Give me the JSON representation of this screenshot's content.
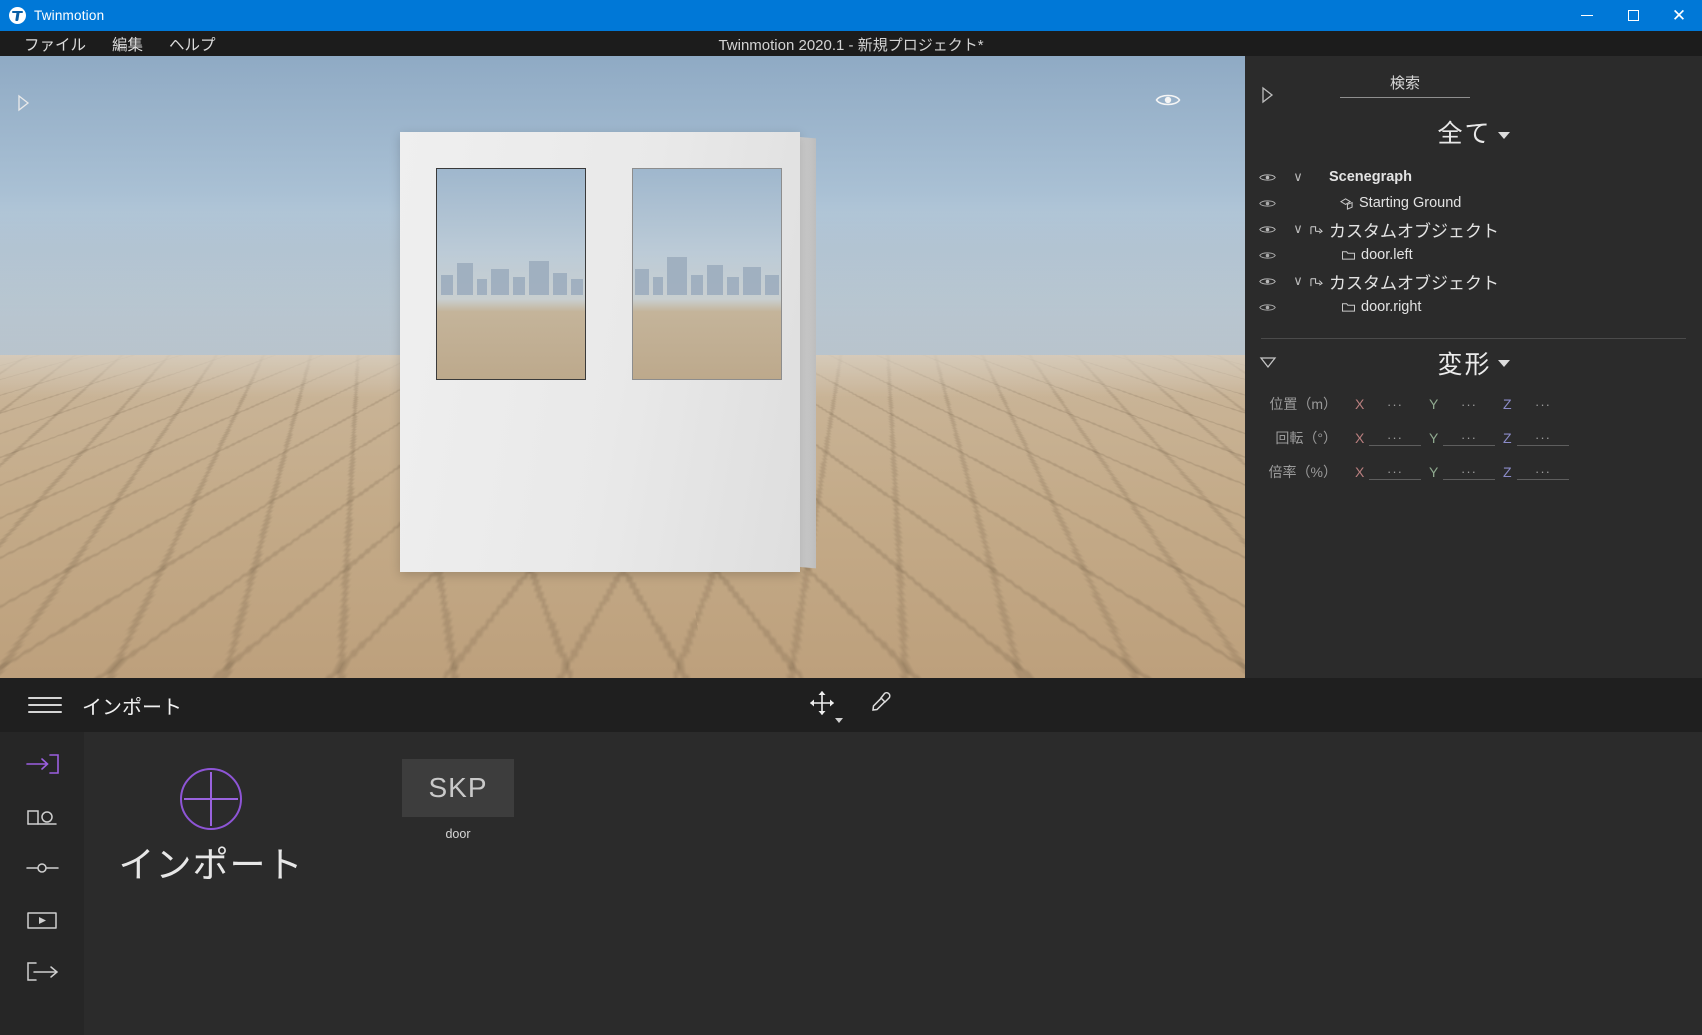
{
  "window": {
    "app_name": "Twinmotion",
    "document_title": "Twinmotion 2020.1 - 新規プロジェクト*",
    "controls": {
      "minimize": "—",
      "maximize": "□",
      "close": "✕"
    },
    "accent_titlebar_color": "#0078d7"
  },
  "menubar": {
    "items": [
      {
        "label": "ファイル"
      },
      {
        "label": "編集"
      },
      {
        "label": "ヘルプ"
      }
    ]
  },
  "viewport": {
    "collapse_arrow": "▷",
    "eye_toggle": "visibility-eye"
  },
  "right_panel": {
    "collapse_arrow": "▷",
    "search": {
      "label": "検索",
      "placeholder": "検索",
      "value": ""
    },
    "filter": {
      "label": "全て",
      "caret": "▾"
    },
    "tree": [
      {
        "label": "Scenegraph",
        "level": 0,
        "chevron": "∨",
        "icon": "",
        "bold": true,
        "japanese": false
      },
      {
        "label": "Starting Ground",
        "level": 1,
        "chevron": "",
        "icon": "ground-icon",
        "bold": false,
        "japanese": false
      },
      {
        "label": "カスタムオブジェクト",
        "level": 0,
        "chevron": "∨",
        "icon": "custom-obj-icon",
        "bold": false,
        "japanese": true
      },
      {
        "label": "door.left",
        "level": 2,
        "chevron": "",
        "icon": "folder-icon",
        "bold": false,
        "japanese": false
      },
      {
        "label": "カスタムオブジェクト",
        "level": 0,
        "chevron": "∨",
        "icon": "custom-obj-icon",
        "bold": false,
        "japanese": true
      },
      {
        "label": "door.right",
        "level": 2,
        "chevron": "",
        "icon": "folder-icon",
        "bold": false,
        "japanese": false
      }
    ],
    "transform": {
      "collapse_arrow": "▽",
      "title": "変形",
      "caret": "▾",
      "rows": [
        {
          "label": "位置（m）",
          "underline": false,
          "axes": [
            {
              "axis": "X",
              "value": "···",
              "color": "#b97f7f"
            },
            {
              "axis": "Y",
              "value": "···",
              "color": "#8fa98f"
            },
            {
              "axis": "Z",
              "value": "···",
              "color": "#8b8bc8"
            }
          ]
        },
        {
          "label": "回転（°）",
          "underline": true,
          "axes": [
            {
              "axis": "X",
              "value": "···",
              "color": "#b97f7f"
            },
            {
              "axis": "Y",
              "value": "···",
              "color": "#8fa98f"
            },
            {
              "axis": "Z",
              "value": "···",
              "color": "#8b8bc8"
            }
          ]
        },
        {
          "label": "倍率（%）",
          "underline": true,
          "axes": [
            {
              "axis": "X",
              "value": "···",
              "color": "#b97f7f"
            },
            {
              "axis": "Y",
              "value": "···",
              "color": "#8fa98f"
            },
            {
              "axis": "Z",
              "value": "···",
              "color": "#8b8bc8"
            }
          ]
        }
      ]
    }
  },
  "bottom_bar": {
    "menu_icon": "hamburger-icon",
    "title": "インポート",
    "tools": [
      {
        "name": "move-gizmo-tool",
        "glyph": "move"
      },
      {
        "name": "eyedropper-tool",
        "glyph": "pipette"
      }
    ]
  },
  "left_rail": {
    "items": [
      {
        "name": "import",
        "icon": "import-icon",
        "active": true
      },
      {
        "name": "measure",
        "icon": "measure-icon",
        "active": false
      },
      {
        "name": "settings-slider",
        "icon": "slider-icon",
        "active": false
      },
      {
        "name": "media",
        "icon": "media-icon",
        "active": false
      },
      {
        "name": "export",
        "icon": "export-icon",
        "active": false
      }
    ]
  },
  "library": {
    "import_tile": {
      "label": "インポート",
      "icon": "plus-circle-icon",
      "accent": "#9a63df"
    },
    "assets": [
      {
        "type": "SKP",
        "name": "door"
      }
    ]
  }
}
